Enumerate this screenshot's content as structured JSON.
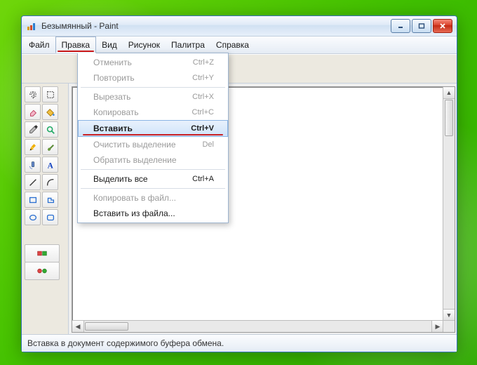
{
  "window": {
    "title": "Безымянный - Paint"
  },
  "menubar": {
    "items": [
      "Файл",
      "Правка",
      "Вид",
      "Рисунок",
      "Палитра",
      "Справка"
    ],
    "open_index": 1
  },
  "dropdown": {
    "groups": [
      [
        {
          "label": "Отменить",
          "shortcut": "Ctrl+Z",
          "enabled": false
        },
        {
          "label": "Повторить",
          "shortcut": "Ctrl+Y",
          "enabled": false
        }
      ],
      [
        {
          "label": "Вырезать",
          "shortcut": "Ctrl+X",
          "enabled": false
        },
        {
          "label": "Копировать",
          "shortcut": "Ctrl+C",
          "enabled": false
        },
        {
          "label": "Вставить",
          "shortcut": "Ctrl+V",
          "enabled": true,
          "highlight": true
        },
        {
          "label": "Очистить выделение",
          "shortcut": "Del",
          "enabled": false
        },
        {
          "label": "Обратить выделение",
          "shortcut": "",
          "enabled": false
        }
      ],
      [
        {
          "label": "Выделить все",
          "shortcut": "Ctrl+A",
          "enabled": true
        }
      ],
      [
        {
          "label": "Копировать в файл...",
          "shortcut": "",
          "enabled": false
        },
        {
          "label": "Вставить из файла...",
          "shortcut": "",
          "enabled": true
        }
      ]
    ]
  },
  "palette": {
    "colors": [
      "#5a5aa8",
      "#8a58c4",
      "#8a58c4",
      "#6d6db9"
    ]
  },
  "tools": [
    {
      "name": "free-select-icon"
    },
    {
      "name": "rect-select-icon"
    },
    {
      "name": "eraser-icon"
    },
    {
      "name": "fill-icon"
    },
    {
      "name": "picker-icon"
    },
    {
      "name": "magnifier-icon"
    },
    {
      "name": "pencil-icon"
    },
    {
      "name": "brush-icon"
    },
    {
      "name": "airbrush-icon"
    },
    {
      "name": "text-icon"
    },
    {
      "name": "line-icon"
    },
    {
      "name": "curve-icon"
    },
    {
      "name": "rect-icon"
    },
    {
      "name": "polygon-icon"
    },
    {
      "name": "ellipse-icon"
    },
    {
      "name": "roundrect-icon"
    }
  ],
  "extra_tools": [
    {
      "name": "option-a-icon"
    },
    {
      "name": "option-b-icon"
    }
  ],
  "statusbar": {
    "text": "Вставка в документ содержимого буфера обмена."
  }
}
